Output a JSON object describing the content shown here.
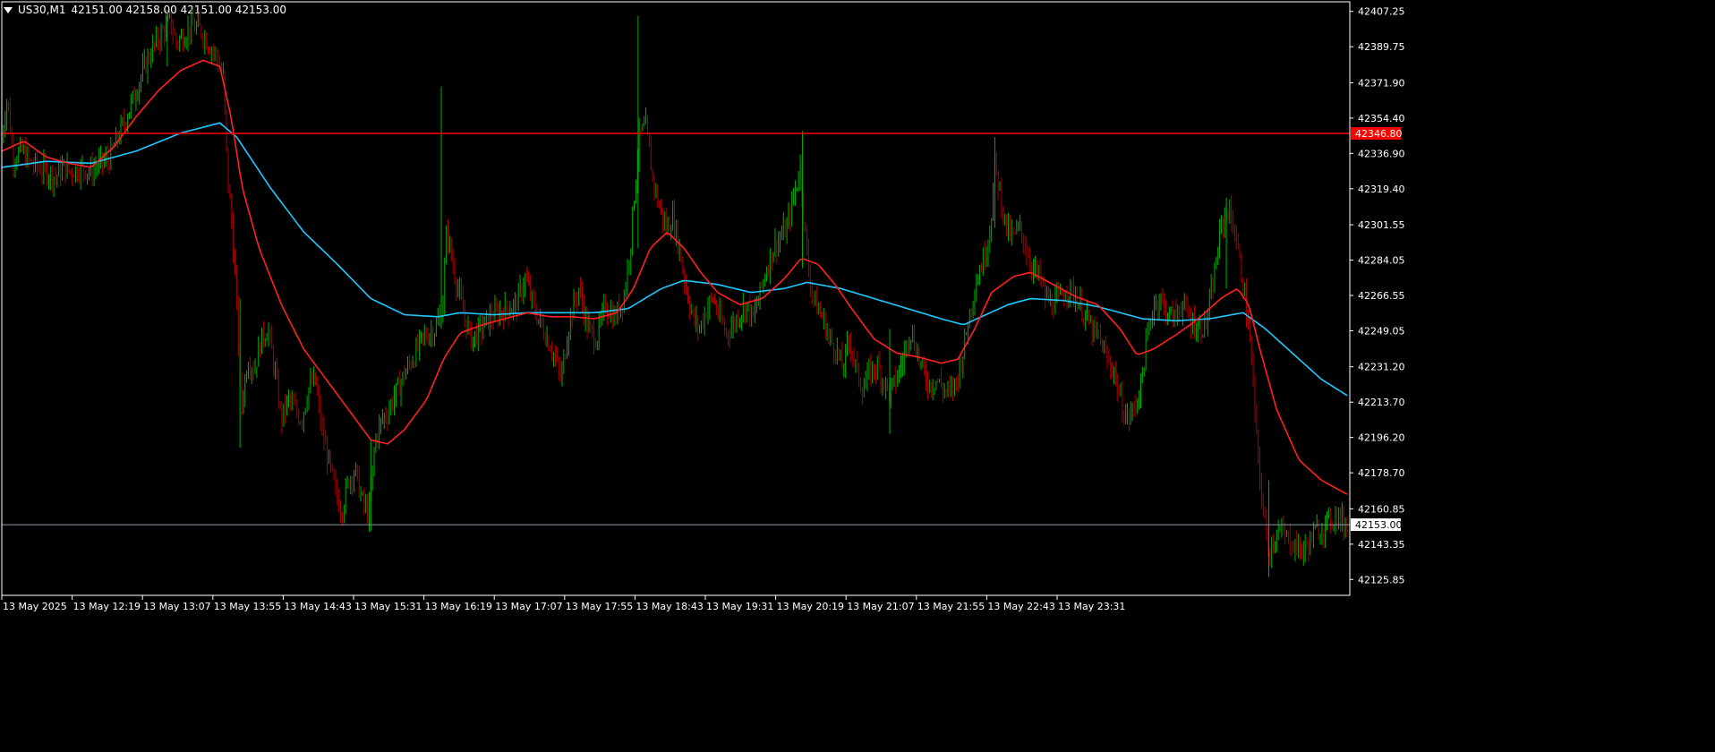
{
  "header": {
    "symbol": "US30,M1",
    "ohlc": "42151.00 42158.00 42151.00 42153.00"
  },
  "colors": {
    "background": "#000000",
    "axis": "#ffffff",
    "bull": "#00b000",
    "bear": "#b00000",
    "ma_fast": "#ff2020",
    "ma_slow": "#1fc8ff",
    "hline": "#ff0000",
    "current_price_line": "#8a9bb0",
    "label_text": "#ffffff"
  },
  "chart_data": {
    "type": "candlestick",
    "symbol": "US30",
    "timeframe": "M1",
    "ylim": [
      42118.0,
      42412.0
    ],
    "y_ticks": [
      "42407.25",
      "42389.75",
      "42371.90",
      "42354.40",
      "42336.90",
      "42319.40",
      "42301.55",
      "42284.05",
      "42266.55",
      "42249.05",
      "42231.20",
      "42213.70",
      "42196.20",
      "42178.70",
      "42160.85",
      "42143.35",
      "42125.85"
    ],
    "x_tick_labels": [
      "13 May 2025",
      "13 May 12:19",
      "13 May 13:07",
      "13 May 13:55",
      "13 May 14:43",
      "13 May 15:31",
      "13 May 16:19",
      "13 May 17:07",
      "13 May 17:55",
      "13 May 18:43",
      "13 May 19:31",
      "13 May 20:19",
      "13 May 21:07",
      "13 May 21:55",
      "13 May 22:43",
      "13 May 23:31"
    ],
    "horizontal_line": {
      "value": 42346.8,
      "label": "42346.80"
    },
    "current_price": {
      "value": 42153.0,
      "label": "42153.00"
    },
    "price_path": [
      [
        0,
        42345
      ],
      [
        5,
        42365
      ],
      [
        10,
        42335
      ],
      [
        18,
        42338
      ],
      [
        25,
        42332
      ],
      [
        32,
        42330
      ],
      [
        40,
        42328
      ],
      [
        48,
        42325
      ],
      [
        55,
        42330
      ],
      [
        62,
        42328
      ],
      [
        72,
        42330
      ],
      [
        80,
        42328
      ],
      [
        88,
        42332
      ],
      [
        96,
        42334
      ],
      [
        104,
        42345
      ],
      [
        112,
        42356
      ],
      [
        120,
        42368
      ],
      [
        128,
        42380
      ],
      [
        136,
        42390
      ],
      [
        144,
        42397
      ],
      [
        150,
        42403
      ],
      [
        156,
        42392
      ],
      [
        162,
        42395
      ],
      [
        170,
        42400
      ],
      [
        178,
        42398
      ],
      [
        186,
        42390
      ],
      [
        192,
        42385
      ],
      [
        198,
        42375
      ],
      [
        202,
        42325
      ],
      [
        206,
        42300
      ],
      [
        210,
        42260
      ],
      [
        214,
        42210
      ],
      [
        220,
        42235
      ],
      [
        226,
        42230
      ],
      [
        232,
        42245
      ],
      [
        238,
        42250
      ],
      [
        244,
        42230
      ],
      [
        250,
        42205
      ],
      [
        256,
        42215
      ],
      [
        262,
        42210
      ],
      [
        268,
        42205
      ],
      [
        274,
        42220
      ],
      [
        280,
        42225
      ],
      [
        286,
        42200
      ],
      [
        292,
        42185
      ],
      [
        298,
        42170
      ],
      [
        304,
        42160
      ],
      [
        310,
        42175
      ],
      [
        316,
        42180
      ],
      [
        322,
        42165
      ],
      [
        328,
        42158
      ],
      [
        334,
        42195
      ],
      [
        340,
        42205
      ],
      [
        346,
        42210
      ],
      [
        352,
        42218
      ],
      [
        358,
        42225
      ],
      [
        364,
        42232
      ],
      [
        370,
        42238
      ],
      [
        376,
        42245
      ],
      [
        382,
        42248
      ],
      [
        388,
        42250
      ],
      [
        394,
        42260
      ],
      [
        398,
        42300
      ],
      [
        402,
        42285
      ],
      [
        408,
        42270
      ],
      [
        414,
        42255
      ],
      [
        420,
        42245
      ],
      [
        428,
        42250
      ],
      [
        436,
        42255
      ],
      [
        444,
        42258
      ],
      [
        452,
        42260
      ],
      [
        460,
        42262
      ],
      [
        468,
        42275
      ],
      [
        476,
        42260
      ],
      [
        484,
        42250
      ],
      [
        492,
        42240
      ],
      [
        500,
        42225
      ],
      [
        508,
        42255
      ],
      [
        516,
        42270
      ],
      [
        524,
        42250
      ],
      [
        532,
        42245
      ],
      [
        540,
        42262
      ],
      [
        548,
        42255
      ],
      [
        556,
        42265
      ],
      [
        562,
        42290
      ],
      [
        566,
        42320
      ],
      [
        570,
        42345
      ],
      [
        576,
        42350
      ],
      [
        582,
        42325
      ],
      [
        588,
        42310
      ],
      [
        594,
        42300
      ],
      [
        600,
        42305
      ],
      [
        606,
        42290
      ],
      [
        612,
        42270
      ],
      [
        618,
        42255
      ],
      [
        624,
        42250
      ],
      [
        630,
        42260
      ],
      [
        636,
        42265
      ],
      [
        642,
        42255
      ],
      [
        648,
        42248
      ],
      [
        654,
        42252
      ],
      [
        660,
        42258
      ],
      [
        666,
        42262
      ],
      [
        672,
        42255
      ],
      [
        678,
        42268
      ],
      [
        684,
        42280
      ],
      [
        690,
        42290
      ],
      [
        696,
        42295
      ],
      [
        702,
        42300
      ],
      [
        708,
        42315
      ],
      [
        714,
        42330
      ],
      [
        718,
        42300
      ],
      [
        722,
        42275
      ],
      [
        728,
        42262
      ],
      [
        734,
        42255
      ],
      [
        740,
        42245
      ],
      [
        746,
        42240
      ],
      [
        752,
        42230
      ],
      [
        758,
        42245
      ],
      [
        764,
        42230
      ],
      [
        770,
        42220
      ],
      [
        776,
        42228
      ],
      [
        782,
        42232
      ],
      [
        788,
        42225
      ],
      [
        794,
        42218
      ],
      [
        800,
        42225
      ],
      [
        806,
        42235
      ],
      [
        812,
        42250
      ],
      [
        818,
        42240
      ],
      [
        824,
        42228
      ],
      [
        830,
        42222
      ],
      [
        836,
        42225
      ],
      [
        842,
        42220
      ],
      [
        848,
        42218
      ],
      [
        854,
        42225
      ],
      [
        860,
        42240
      ],
      [
        866,
        42260
      ],
      [
        872,
        42275
      ],
      [
        878,
        42285
      ],
      [
        884,
        42300
      ],
      [
        888,
        42330
      ],
      [
        892,
        42320
      ],
      [
        898,
        42300
      ],
      [
        904,
        42295
      ],
      [
        910,
        42300
      ],
      [
        916,
        42290
      ],
      [
        922,
        42280
      ],
      [
        928,
        42275
      ],
      [
        934,
        42265
      ],
      [
        940,
        42262
      ],
      [
        946,
        42265
      ],
      [
        952,
        42270
      ],
      [
        958,
        42268
      ],
      [
        964,
        42262
      ],
      [
        970,
        42255
      ],
      [
        976,
        42248
      ],
      [
        982,
        42245
      ],
      [
        988,
        42235
      ],
      [
        994,
        42230
      ],
      [
        1000,
        42215
      ],
      [
        1006,
        42205
      ],
      [
        1012,
        42210
      ],
      [
        1018,
        42220
      ],
      [
        1024,
        42245
      ],
      [
        1030,
        42262
      ],
      [
        1036,
        42265
      ],
      [
        1042,
        42258
      ],
      [
        1048,
        42255
      ],
      [
        1054,
        42262
      ],
      [
        1060,
        42258
      ],
      [
        1066,
        42252
      ],
      [
        1072,
        42250
      ],
      [
        1078,
        42255
      ],
      [
        1084,
        42275
      ],
      [
        1090,
        42300
      ],
      [
        1096,
        42310
      ],
      [
        1102,
        42300
      ],
      [
        1108,
        42280
      ],
      [
        1114,
        42255
      ],
      [
        1118,
        42230
      ],
      [
        1122,
        42195
      ],
      [
        1126,
        42170
      ],
      [
        1130,
        42150
      ],
      [
        1134,
        42140
      ],
      [
        1140,
        42150
      ],
      [
        1146,
        42148
      ],
      [
        1152,
        42145
      ],
      [
        1158,
        42142
      ],
      [
        1164,
        42140
      ],
      [
        1170,
        42145
      ],
      [
        1176,
        42150
      ],
      [
        1182,
        42152
      ],
      [
        1188,
        42155
      ],
      [
        1194,
        42158
      ],
      [
        1200,
        42153
      ],
      [
        1203,
        42153
      ]
    ],
    "ma_fast_path": [
      [
        0,
        42338
      ],
      [
        20,
        42343
      ],
      [
        40,
        42335
      ],
      [
        60,
        42332
      ],
      [
        80,
        42330
      ],
      [
        100,
        42340
      ],
      [
        120,
        42355
      ],
      [
        140,
        42368
      ],
      [
        160,
        42378
      ],
      [
        180,
        42383
      ],
      [
        195,
        42380
      ],
      [
        205,
        42355
      ],
      [
        215,
        42320
      ],
      [
        230,
        42290
      ],
      [
        250,
        42262
      ],
      [
        270,
        42240
      ],
      [
        290,
        42225
      ],
      [
        310,
        42210
      ],
      [
        330,
        42195
      ],
      [
        345,
        42193
      ],
      [
        360,
        42200
      ],
      [
        380,
        42215
      ],
      [
        395,
        42235
      ],
      [
        410,
        42248
      ],
      [
        430,
        42252
      ],
      [
        450,
        42255
      ],
      [
        470,
        42258
      ],
      [
        490,
        42256
      ],
      [
        510,
        42256
      ],
      [
        530,
        42255
      ],
      [
        550,
        42258
      ],
      [
        565,
        42270
      ],
      [
        580,
        42290
      ],
      [
        595,
        42298
      ],
      [
        610,
        42290
      ],
      [
        625,
        42278
      ],
      [
        640,
        42268
      ],
      [
        660,
        42262
      ],
      [
        680,
        42265
      ],
      [
        700,
        42275
      ],
      [
        715,
        42285
      ],
      [
        730,
        42282
      ],
      [
        745,
        42272
      ],
      [
        760,
        42260
      ],
      [
        780,
        42245
      ],
      [
        800,
        42238
      ],
      [
        820,
        42236
      ],
      [
        840,
        42233
      ],
      [
        855,
        42235
      ],
      [
        870,
        42250
      ],
      [
        885,
        42268
      ],
      [
        905,
        42276
      ],
      [
        920,
        42278
      ],
      [
        940,
        42272
      ],
      [
        960,
        42266
      ],
      [
        980,
        42262
      ],
      [
        1000,
        42250
      ],
      [
        1015,
        42237
      ],
      [
        1030,
        42240
      ],
      [
        1050,
        42247
      ],
      [
        1070,
        42255
      ],
      [
        1090,
        42265
      ],
      [
        1105,
        42270
      ],
      [
        1115,
        42262
      ],
      [
        1125,
        42240
      ],
      [
        1140,
        42210
      ],
      [
        1160,
        42185
      ],
      [
        1180,
        42175
      ],
      [
        1203,
        42168
      ]
    ],
    "ma_slow_path": [
      [
        0,
        42330
      ],
      [
        40,
        42333
      ],
      [
        80,
        42332
      ],
      [
        120,
        42338
      ],
      [
        160,
        42347
      ],
      [
        195,
        42352
      ],
      [
        210,
        42345
      ],
      [
        240,
        42320
      ],
      [
        270,
        42298
      ],
      [
        300,
        42282
      ],
      [
        330,
        42265
      ],
      [
        360,
        42257
      ],
      [
        390,
        42256
      ],
      [
        410,
        42258
      ],
      [
        440,
        42257
      ],
      [
        470,
        42258
      ],
      [
        500,
        42258
      ],
      [
        530,
        42258
      ],
      [
        560,
        42260
      ],
      [
        590,
        42270
      ],
      [
        610,
        42274
      ],
      [
        640,
        42272
      ],
      [
        670,
        42268
      ],
      [
        700,
        42270
      ],
      [
        720,
        42273
      ],
      [
        750,
        42270
      ],
      [
        780,
        42265
      ],
      [
        810,
        42260
      ],
      [
        840,
        42255
      ],
      [
        860,
        42252
      ],
      [
        880,
        42257
      ],
      [
        900,
        42262
      ],
      [
        920,
        42265
      ],
      [
        950,
        42264
      ],
      [
        980,
        42261
      ],
      [
        1000,
        42258
      ],
      [
        1020,
        42255
      ],
      [
        1050,
        42254
      ],
      [
        1080,
        42255
      ],
      [
        1110,
        42258
      ],
      [
        1130,
        42250
      ],
      [
        1160,
        42235
      ],
      [
        1180,
        42225
      ],
      [
        1203,
        42217
      ]
    ]
  }
}
